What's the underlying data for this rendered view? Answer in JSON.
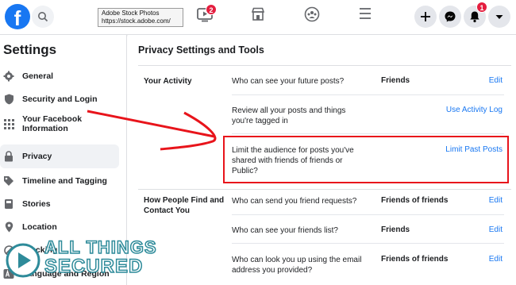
{
  "topbar": {
    "logo_letter": "f",
    "overlay_title": "Adobe Stock Photos",
    "overlay_url": "https://stock.adobe.com/",
    "watch_badge": "2",
    "notifications_badge": "1"
  },
  "sidebar": {
    "title": "Settings",
    "items": [
      {
        "label": "General",
        "icon": "gear-icon"
      },
      {
        "label": "Security and Login",
        "icon": "shield-icon"
      },
      {
        "label": "Your Facebook Information",
        "icon": "grid-icon"
      },
      {
        "label": "Privacy",
        "icon": "lock-icon"
      },
      {
        "label": "Timeline and Tagging",
        "icon": "tag-icon"
      },
      {
        "label": "Stories",
        "icon": "book-icon"
      },
      {
        "label": "Location",
        "icon": "location-icon"
      },
      {
        "label": "Blocking",
        "icon": "block-icon"
      },
      {
        "label": "Language and Region",
        "icon": "language-icon"
      }
    ]
  },
  "main": {
    "title": "Privacy Settings and Tools",
    "sections": [
      {
        "label": "Your Activity",
        "rows": [
          {
            "question": "Who can see your future posts?",
            "value": "Friends",
            "action": "Edit"
          },
          {
            "question": "Review all your posts and things you're tagged in",
            "value": "",
            "action": "Use Activity Log"
          },
          {
            "question": "Limit the audience for posts you've shared with friends of friends or Public?",
            "value": "",
            "action": "Limit Past Posts"
          }
        ]
      },
      {
        "label": "How People Find and Contact You",
        "rows": [
          {
            "question": "Who can send you friend requests?",
            "value": "Friends of friends",
            "action": "Edit"
          },
          {
            "question": "Who can see your friends list?",
            "value": "Friends",
            "action": "Edit"
          },
          {
            "question": "Who can look you up using the email address you provided?",
            "value": "Friends of friends",
            "action": "Edit"
          }
        ]
      }
    ]
  },
  "watermark": {
    "line1": "ALL THINGS",
    "line2": "SECURED"
  },
  "colors": {
    "brand": "#1877f2",
    "annotation": "#e8141b",
    "badge": "#e41e3f",
    "watermark": "#2e8b9a"
  }
}
